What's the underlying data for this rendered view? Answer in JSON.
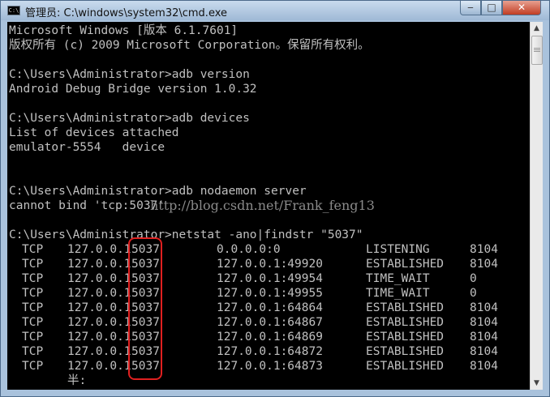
{
  "window": {
    "title": "管理员: C:\\windows\\system32\\cmd.exe",
    "icon": "C:\\",
    "controls": {
      "minimize": "‒",
      "maximize": "□",
      "close": "✕"
    }
  },
  "console": {
    "lines": [
      "Microsoft Windows [版本 6.1.7601]",
      "版权所有 (c) 2009 Microsoft Corporation。保留所有权利。",
      "",
      "C:\\Users\\Administrator>adb version",
      "Android Debug Bridge version 1.0.32",
      "",
      "C:\\Users\\Administrator>adb devices",
      "List of devices attached",
      "emulator-5554   device",
      "",
      "",
      "C:\\Users\\Administrator>adb nodaemon server",
      "cannot bind 'tcp:5037'",
      "",
      "C:\\Users\\Administrator>netstat -ano|findstr \"5037\""
    ],
    "watermark": "http://blog.csdn.net/Frank_feng13",
    "netstat_rows": [
      {
        "proto": "TCP",
        "local_ip": "127.0.0.1",
        "local_port": "5037",
        "foreign": "0.0.0.0:0",
        "state": "LISTENING",
        "pid": "8104"
      },
      {
        "proto": "TCP",
        "local_ip": "127.0.0.1",
        "local_port": "5037",
        "foreign": "127.0.0.1:49920",
        "state": "ESTABLISHED",
        "pid": "8104"
      },
      {
        "proto": "TCP",
        "local_ip": "127.0.0.1",
        "local_port": "5037",
        "foreign": "127.0.0.1:49954",
        "state": "TIME_WAIT",
        "pid": "0"
      },
      {
        "proto": "TCP",
        "local_ip": "127.0.0.1",
        "local_port": "5037",
        "foreign": "127.0.0.1:49955",
        "state": "TIME_WAIT",
        "pid": "0"
      },
      {
        "proto": "TCP",
        "local_ip": "127.0.0.1",
        "local_port": "5037",
        "foreign": "127.0.0.1:64864",
        "state": "ESTABLISHED",
        "pid": "8104"
      },
      {
        "proto": "TCP",
        "local_ip": "127.0.0.1",
        "local_port": "5037",
        "foreign": "127.0.0.1:64867",
        "state": "ESTABLISHED",
        "pid": "8104"
      },
      {
        "proto": "TCP",
        "local_ip": "127.0.0.1",
        "local_port": "5037",
        "foreign": "127.0.0.1:64869",
        "state": "ESTABLISHED",
        "pid": "8104"
      },
      {
        "proto": "TCP",
        "local_ip": "127.0.0.1",
        "local_port": "5037",
        "foreign": "127.0.0.1:64872",
        "state": "ESTABLISHED",
        "pid": "8104"
      },
      {
        "proto": "TCP",
        "local_ip": "127.0.0.1",
        "local_port": "5037",
        "foreign": "127.0.0.1:64873",
        "state": "ESTABLISHED",
        "pid": "8104"
      }
    ],
    "ime_status": "半:"
  },
  "scrollbar": {
    "up_arrow": "▲",
    "down_arrow": "▼"
  },
  "colors": {
    "console_bg": "#000000",
    "console_text": "#c0c0c0",
    "highlight_border": "#e02020",
    "watermark": "#8a8a8a"
  }
}
